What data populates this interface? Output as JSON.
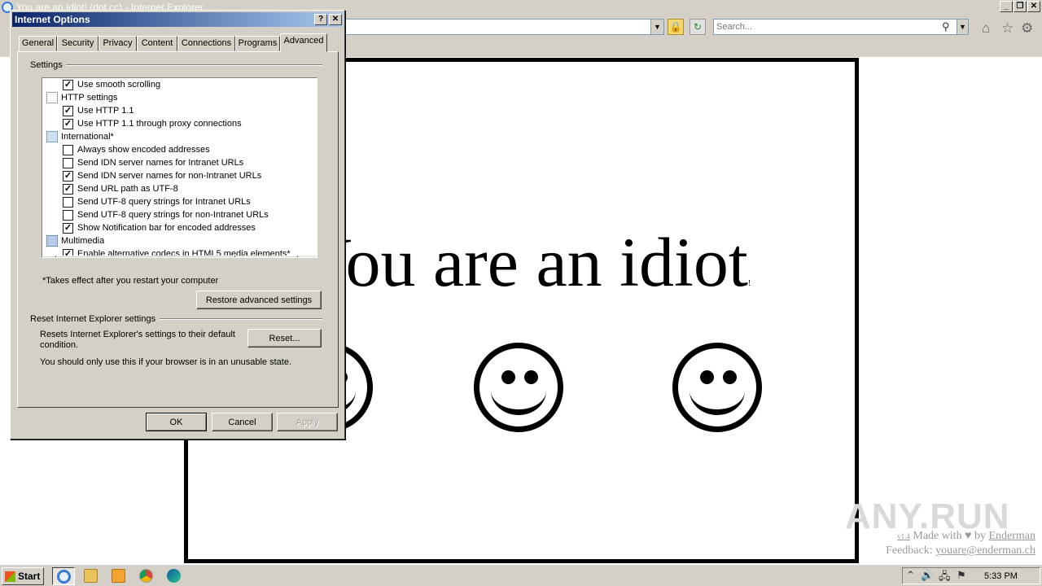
{
  "browser": {
    "title": "You are an Idiot! (dot cc) - Internet Explorer",
    "search_placeholder": "Search...",
    "caption_buttons": [
      "_",
      "❐",
      "✕"
    ]
  },
  "page": {
    "headline": "You are an idiot",
    "headline_trailing_mark": "!",
    "smiley_count": 3,
    "credits": {
      "version": "v1.4",
      "made_with": "Made with",
      "heart": "♥",
      "by": "by",
      "author": "Enderman",
      "feedback_label": "Feedback:",
      "feedback_email": "youare@enderman.ch"
    },
    "watermark": "ANY.RUN"
  },
  "dialog": {
    "title": "Internet Options",
    "help_button": "?",
    "close_button": "✕",
    "tabs": [
      {
        "label": "General",
        "active": false
      },
      {
        "label": "Security",
        "active": false
      },
      {
        "label": "Privacy",
        "active": false
      },
      {
        "label": "Content",
        "active": false
      },
      {
        "label": "Connections",
        "active": false
      },
      {
        "label": "Programs",
        "active": false
      },
      {
        "label": "Advanced",
        "active": true
      }
    ],
    "settings_label": "Settings",
    "settings": [
      {
        "type": "checkbox",
        "label": "Use smooth scrolling",
        "checked": true
      },
      {
        "type": "category",
        "icon": "page-icon",
        "label": "HTTP settings"
      },
      {
        "type": "checkbox",
        "label": "Use HTTP 1.1",
        "checked": true
      },
      {
        "type": "checkbox",
        "label": "Use HTTP 1.1 through proxy connections",
        "checked": true
      },
      {
        "type": "category",
        "icon": "globe-icon",
        "label": "International*"
      },
      {
        "type": "checkbox",
        "label": "Always show encoded addresses",
        "checked": false
      },
      {
        "type": "checkbox",
        "label": "Send IDN server names for Intranet URLs",
        "checked": false
      },
      {
        "type": "checkbox",
        "label": "Send IDN server names for non-Intranet URLs",
        "checked": true
      },
      {
        "type": "checkbox",
        "label": "Send URL path as UTF-8",
        "checked": true
      },
      {
        "type": "checkbox",
        "label": "Send UTF-8 query strings for Intranet URLs",
        "checked": false
      },
      {
        "type": "checkbox",
        "label": "Send UTF-8 query strings for non-Intranet URLs",
        "checked": false
      },
      {
        "type": "checkbox",
        "label": "Show Notification bar for encoded addresses",
        "checked": true
      },
      {
        "type": "category",
        "icon": "multimedia-icon",
        "label": "Multimedia"
      },
      {
        "type": "checkbox",
        "label": "Enable alternative codecs in HTML5 media elements*",
        "checked": true
      }
    ],
    "restart_note": "*Takes effect after you restart your computer",
    "restore_button": "Restore advanced settings",
    "reset_group_label": "Reset Internet Explorer settings",
    "reset_description_line1": "Resets Internet Explorer's settings to their default",
    "reset_description_line2": "condition.",
    "reset_button": "Reset...",
    "reset_warning": "You should only use this if your browser is in an unusable state.",
    "ok_button": "OK",
    "cancel_button": "Cancel",
    "apply_button": "Apply"
  },
  "taskbar": {
    "start_label": "Start",
    "apps": [
      "internet-explorer-icon",
      "file-explorer-icon",
      "media-player-icon",
      "chrome-icon",
      "edge-icon"
    ],
    "clock": "5:33 PM"
  }
}
